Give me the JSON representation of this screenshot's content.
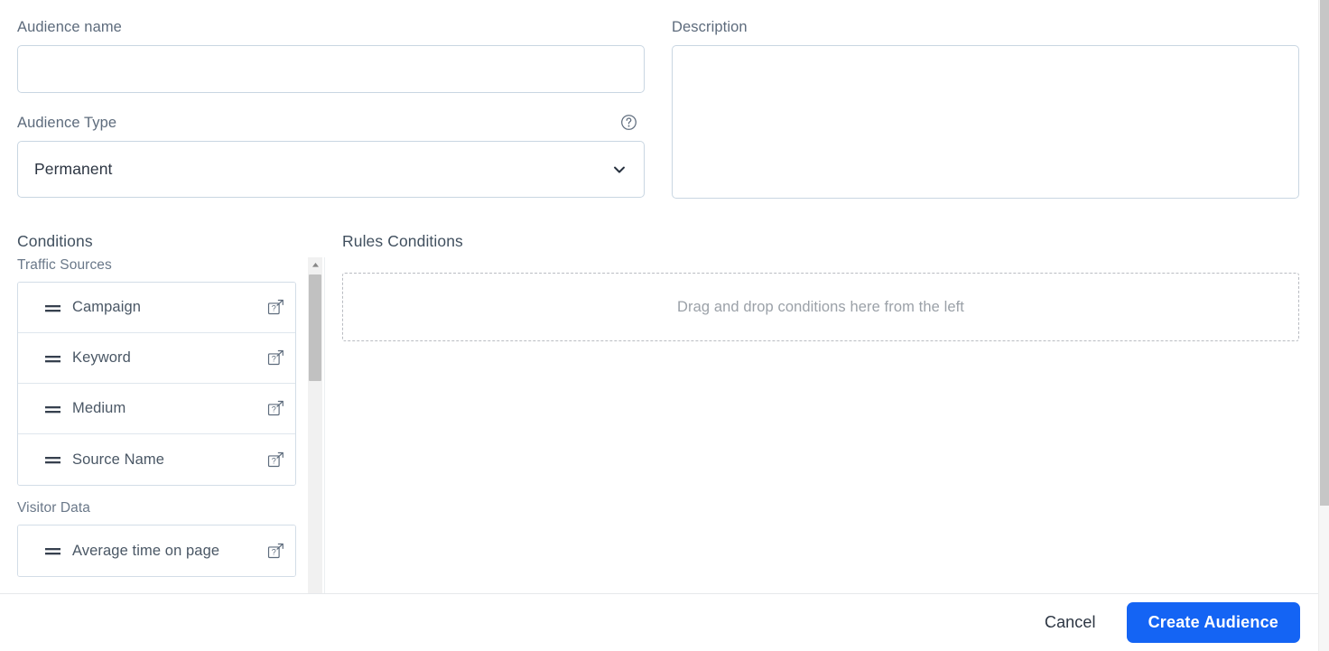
{
  "form": {
    "audience_name": {
      "label": "Audience name",
      "value": "",
      "placeholder": ""
    },
    "audience_type": {
      "label": "Audience Type",
      "selected": "Permanent",
      "options": [
        "Permanent"
      ],
      "help_icon": "question-circle-icon",
      "chevron_icon": "chevron-down-icon"
    },
    "description": {
      "label": "Description",
      "value": "",
      "placeholder": ""
    }
  },
  "conditions": {
    "title": "Conditions",
    "groups": [
      {
        "label": "Traffic Sources",
        "items": [
          {
            "label": "Campaign",
            "drag_icon": "drag-handle-icon",
            "help_icon": "help-external-link-icon"
          },
          {
            "label": "Keyword",
            "drag_icon": "drag-handle-icon",
            "help_icon": "help-external-link-icon"
          },
          {
            "label": "Medium",
            "drag_icon": "drag-handle-icon",
            "help_icon": "help-external-link-icon"
          },
          {
            "label": "Source Name",
            "drag_icon": "drag-handle-icon",
            "help_icon": "help-external-link-icon"
          }
        ]
      },
      {
        "label": "Visitor Data",
        "items": [
          {
            "label": "Average time on page",
            "drag_icon": "drag-handle-icon",
            "help_icon": "help-external-link-icon"
          }
        ]
      }
    ],
    "scrollbar": {
      "up_arrow_icon": "caret-up-icon"
    }
  },
  "rules": {
    "title": "Rules Conditions",
    "dropzone_text": "Drag and drop conditions here from the left"
  },
  "footer": {
    "cancel_label": "Cancel",
    "create_label": "Create Audience"
  },
  "colors": {
    "primary": "#1464f4",
    "label_text": "#5d6b7c",
    "input_border": "#c9d6e2",
    "item_border": "#d3dde7",
    "placeholder_text": "#9ba1a8",
    "scrollbar_thumb": "#c1c1c1"
  }
}
